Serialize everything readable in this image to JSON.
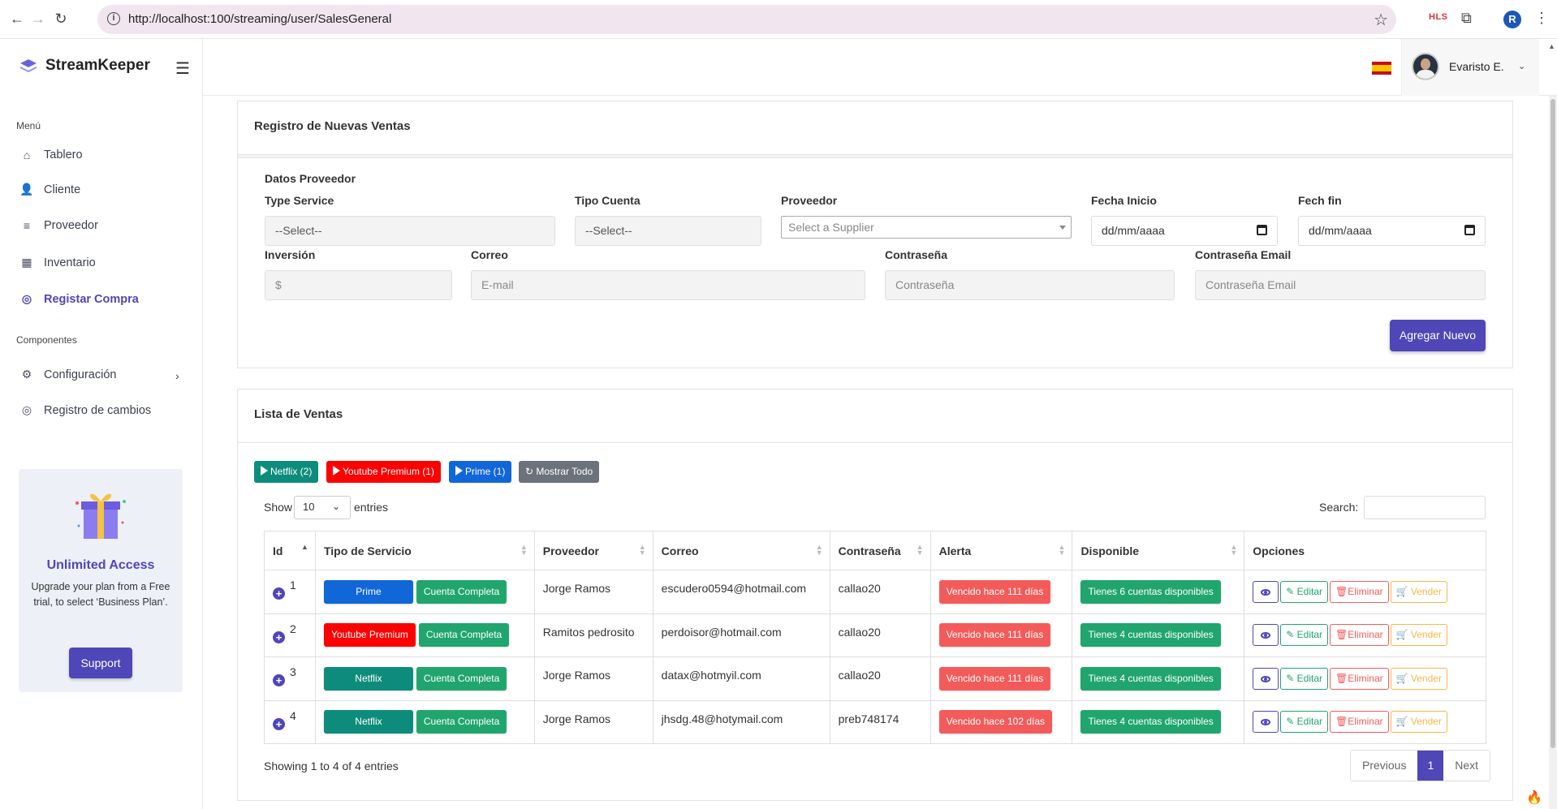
{
  "browser": {
    "url": "http://localhost:100/streaming/user/SalesGeneral",
    "ext_label": "HLS",
    "profile_initial": "R"
  },
  "sidebar": {
    "brand": "StreamKeeper",
    "menu_title": "Menú",
    "items": [
      {
        "label": "Tablero",
        "icon": "home-icon"
      },
      {
        "label": "Cliente",
        "icon": "user-plus-icon"
      },
      {
        "label": "Proveedor",
        "icon": "user-list-icon"
      },
      {
        "label": "Inventario",
        "icon": "store-icon"
      },
      {
        "label": "Registar Compra",
        "icon": "circle-check-icon",
        "active": true
      }
    ],
    "components_title": "Componentes",
    "components": [
      {
        "label": "Configuración",
        "icon": "gear-icon"
      },
      {
        "label": "Registro de cambios",
        "icon": "circle-check-icon"
      }
    ],
    "promo": {
      "title": "Unlimited Access",
      "description": "Upgrade your plan from a Free trial, to select ‘Business Plan’.",
      "button": "Support"
    }
  },
  "topbar": {
    "user_name": "Evaristo E.",
    "language": "es"
  },
  "form": {
    "card_title": "Registro de Nuevas Ventas",
    "section_title": "Datos Proveedor",
    "type_service": {
      "label": "Type Service",
      "value": "--Select--"
    },
    "tipo_cuenta": {
      "label": "Tipo Cuenta",
      "value": "--Select--"
    },
    "proveedor": {
      "label": "Proveedor",
      "placeholder": "Select a Supplier"
    },
    "fecha_inicio": {
      "label": "Fecha Inicio",
      "value": "dd/mm/aaaa"
    },
    "fecha_fin": {
      "label": "Fech fin",
      "value": "dd/mm/aaaa"
    },
    "inversion": {
      "label": "Inversión",
      "placeholder": "$"
    },
    "correo": {
      "label": "Correo",
      "placeholder": "E-mail"
    },
    "contrasena": {
      "label": "Contraseña",
      "placeholder": "Contraseña"
    },
    "contrasena_email": {
      "label": "Contraseña Email",
      "placeholder": "Contraseña Email"
    },
    "submit": "Agregar Nuevo"
  },
  "list": {
    "card_title": "Lista de Ventas",
    "filters": [
      {
        "label": "Netflix (2)",
        "color": "#0e8c7b"
      },
      {
        "label": "Youtube Premium (1)",
        "color": "#ff0000"
      },
      {
        "label": "Prime (1)",
        "color": "#1166d8"
      },
      {
        "label": "Mostrar Todo",
        "color": "#6c727c"
      }
    ],
    "show_label": "Show",
    "page_length": "10",
    "entries_label": "entries",
    "search_label": "Search:",
    "columns": [
      "Id",
      "Tipo de Servicio",
      "Proveedor",
      "Correo",
      "Contraseña",
      "Alerta",
      "Disponible",
      "Opciones"
    ],
    "rows": [
      {
        "id": "1",
        "service": "Prime",
        "service_type": "prime",
        "account": "Cuenta Completa",
        "provider": "Jorge Ramos",
        "email": "escudero0594@hotmail.com",
        "password": "callao20",
        "alert": "Vencido hace 111 días",
        "available": "Tienes 6 cuentas disponibles"
      },
      {
        "id": "2",
        "service": "Youtube Premium",
        "service_type": "yt",
        "account": "Cuenta Completa",
        "provider": "Ramitos pedrosito",
        "email": "perdoisor@hotmail.com",
        "password": "callao20",
        "alert": "Vencido hace 111 días",
        "available": "Tienes 4 cuentas disponibles"
      },
      {
        "id": "3",
        "service": "Netflix",
        "service_type": "nf",
        "account": "Cuenta Completa",
        "provider": "Jorge Ramos",
        "email": "datax@hotmyil.com",
        "password": "callao20",
        "alert": "Vencido hace 111 días",
        "available": "Tienes 4 cuentas disponibles"
      },
      {
        "id": "4",
        "service": "Netflix",
        "service_type": "nf",
        "account": "Cuenta Completa",
        "provider": "Jorge Ramos",
        "email": "jhsdg.48@hotymail.com",
        "password": "preb748174",
        "alert": "Vencido hace 102 días",
        "available": "Tienes 4 cuentas disponibles"
      }
    ],
    "actions": {
      "edit": "Editar",
      "delete": "Eliminar",
      "sell": "Vender"
    },
    "showing": "Showing 1 to 4 of 4 entries",
    "pagination": {
      "previous": "Previous",
      "current": "1",
      "next": "Next"
    }
  }
}
